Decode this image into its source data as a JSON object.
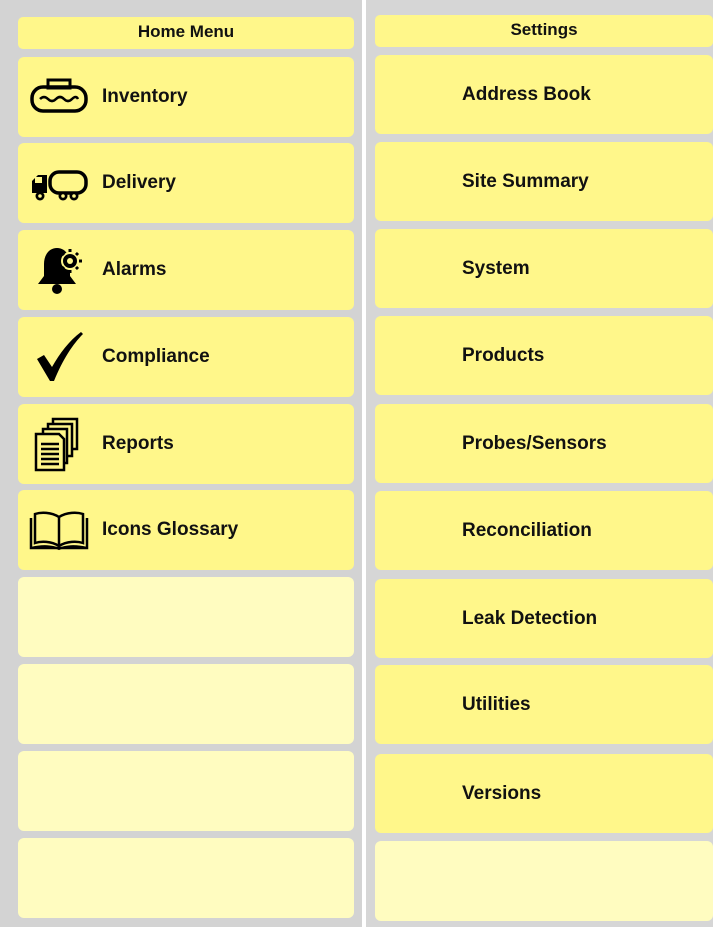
{
  "home_menu": {
    "title": "Home Menu",
    "items": [
      {
        "label": "Inventory",
        "icon": "tank-icon"
      },
      {
        "label": "Delivery",
        "icon": "tanker-truck-icon"
      },
      {
        "label": "Alarms",
        "icon": "alarm-bell-icon"
      },
      {
        "label": "Compliance",
        "icon": "checkmark-icon"
      },
      {
        "label": "Reports",
        "icon": "reports-stack-icon"
      },
      {
        "label": "Icons Glossary",
        "icon": "open-book-icon"
      }
    ]
  },
  "settings": {
    "title": "Settings",
    "items": [
      {
        "label": "Address Book"
      },
      {
        "label": "Site Summary"
      },
      {
        "label": "System"
      },
      {
        "label": "Products"
      },
      {
        "label": "Probes/Sensors"
      },
      {
        "label": "Reconciliation"
      },
      {
        "label": "Leak Detection"
      },
      {
        "label": "Utilities"
      },
      {
        "label": "Versions"
      }
    ]
  },
  "colors": {
    "button": "#fff78a",
    "button_empty": "#fffcc0",
    "background": "#d3d3d3",
    "divider": "#ffffff"
  }
}
